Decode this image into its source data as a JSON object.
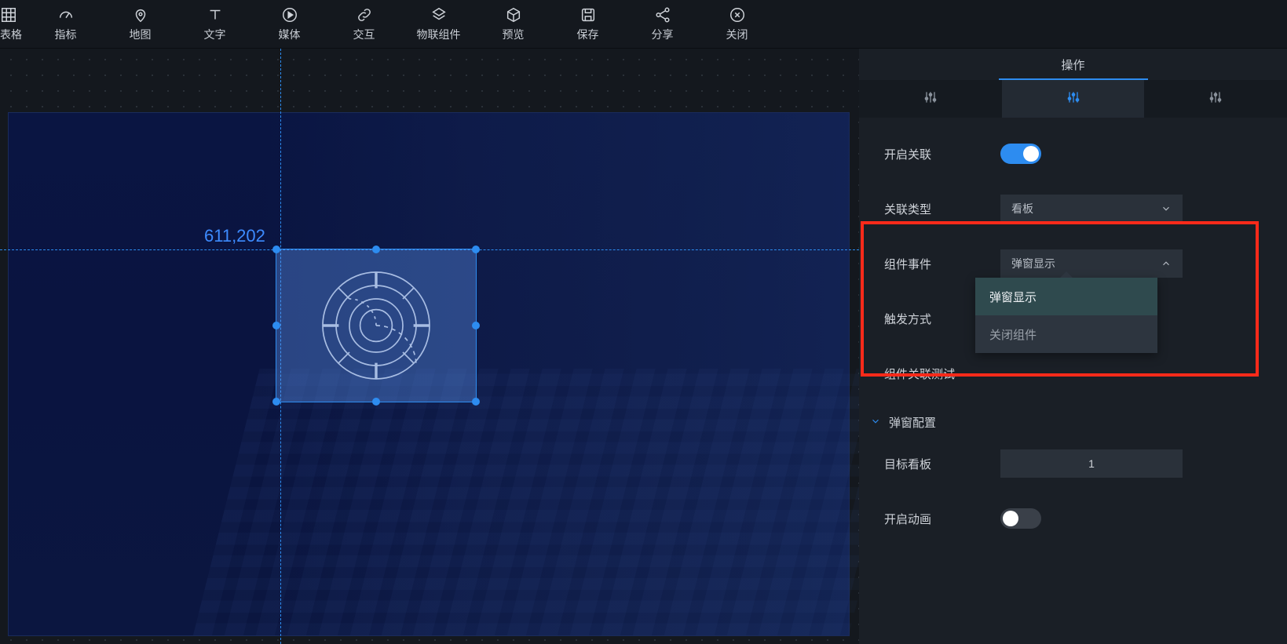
{
  "toolbar": [
    {
      "id": "table",
      "label": "表格",
      "icon": "grid"
    },
    {
      "id": "indicator",
      "label": "指标",
      "icon": "gauge"
    },
    {
      "id": "map",
      "label": "地图",
      "icon": "pin"
    },
    {
      "id": "text",
      "label": "文字",
      "icon": "text"
    },
    {
      "id": "media",
      "label": "媒体",
      "icon": "play"
    },
    {
      "id": "interact",
      "label": "交互",
      "icon": "link"
    },
    {
      "id": "iot",
      "label": "物联组件",
      "icon": "iot"
    },
    {
      "id": "preview",
      "label": "预览",
      "icon": "cube"
    },
    {
      "id": "save",
      "label": "保存",
      "icon": "save"
    },
    {
      "id": "share",
      "label": "分享",
      "icon": "share"
    },
    {
      "id": "close",
      "label": "关闭",
      "icon": "close-circle"
    }
  ],
  "canvas": {
    "coord_label": "611,202"
  },
  "panel": {
    "title": "操作",
    "fields": {
      "enable_link": {
        "label": "开启关联",
        "value": true
      },
      "link_type": {
        "label": "关联类型",
        "value": "看板"
      },
      "comp_event": {
        "label": "组件事件",
        "value": "弹窗显示"
      },
      "trigger": {
        "label": "触发方式"
      },
      "comp_link_test": {
        "label": "组件关联测试"
      },
      "popup_section": {
        "label": "弹窗配置"
      },
      "target_board": {
        "label": "目标看板",
        "value": "1"
      },
      "enable_anim": {
        "label": "开启动画",
        "value": false
      }
    },
    "dropdown": {
      "options": [
        "弹窗显示",
        "关闭组件"
      ],
      "selected": "弹窗显示"
    }
  }
}
